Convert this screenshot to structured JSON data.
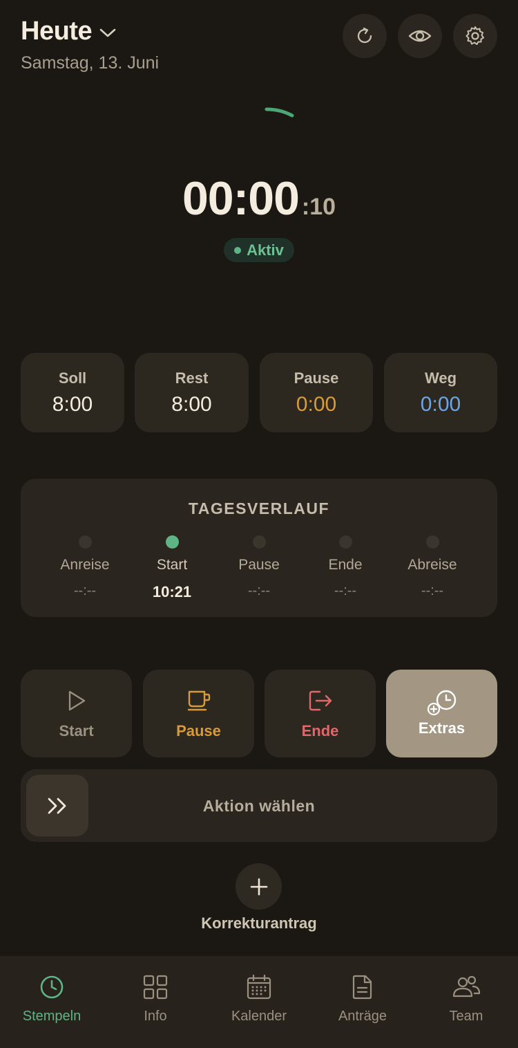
{
  "header": {
    "title": "Heute",
    "date": "Samstag, 13. Juni"
  },
  "icons": {
    "dropdown": "chevron-down-icon",
    "refresh": "refresh-icon",
    "visibility": "eye-icon",
    "settings": "gear-icon"
  },
  "timer": {
    "main": "00:00",
    "seconds": ":10",
    "status": "Aktiv"
  },
  "stats": [
    {
      "label": "Soll",
      "value": "8:00",
      "color": "#f4eddf"
    },
    {
      "label": "Rest",
      "value": "8:00",
      "color": "#f4eddf"
    },
    {
      "label": "Pause",
      "value": "0:00",
      "color": "#d99a3a"
    },
    {
      "label": "Weg",
      "value": "0:00",
      "color": "#6aa5e6"
    }
  ],
  "tagesverlauf": {
    "title": "TAGESVERLAUF",
    "steps": [
      {
        "name": "Anreise",
        "time": "--:--",
        "active": false
      },
      {
        "name": "Start",
        "time": "10:21",
        "active": true
      },
      {
        "name": "Pause",
        "time": "--:--",
        "active": false
      },
      {
        "name": "Ende",
        "time": "--:--",
        "active": false
      },
      {
        "name": "Abreise",
        "time": "--:--",
        "active": false
      }
    ]
  },
  "actions": [
    {
      "label": "Start",
      "icon": "play-icon",
      "color": "#9a9181"
    },
    {
      "label": "Pause",
      "icon": "coffee-cup-icon",
      "color": "#d99a3a"
    },
    {
      "label": "Ende",
      "icon": "logout-icon",
      "color": "#e0686a"
    },
    {
      "label": "Extras",
      "icon": "clock-plus-icon",
      "color": "#ffffff"
    }
  ],
  "slider": {
    "label": "Aktion wählen"
  },
  "correction": {
    "label": "Korrekturantrag"
  },
  "nav": [
    {
      "label": "Stempeln",
      "icon": "clock-icon",
      "selected": true
    },
    {
      "label": "Info",
      "icon": "grid-icon",
      "selected": false
    },
    {
      "label": "Kalender",
      "icon": "calendar-icon",
      "selected": false
    },
    {
      "label": "Anträge",
      "icon": "document-icon",
      "selected": false
    },
    {
      "label": "Team",
      "icon": "team-icon",
      "selected": false
    }
  ],
  "colors": {
    "background": "#1b1814",
    "card": "#2d281f",
    "accent_green": "#5fb486",
    "pause_orange": "#d99a3a",
    "weg_blue": "#6aa5e6",
    "ende_red": "#e0686a",
    "extras_bg": "#a39783"
  }
}
